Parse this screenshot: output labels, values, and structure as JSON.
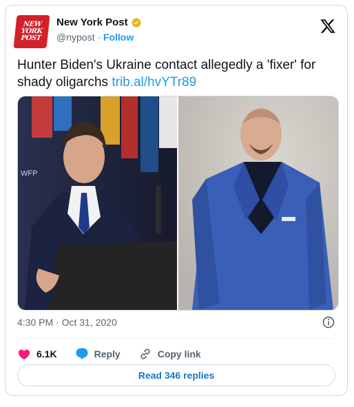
{
  "account": {
    "avatar_lines": [
      "NEW",
      "YORK",
      "POST"
    ],
    "name": "New York Post",
    "verified_icon": "verified-badge-icon",
    "handle": "@nypost",
    "separator": "·",
    "follow_label": "Follow"
  },
  "platform_icon": "x-logo-icon",
  "tweet": {
    "text": "Hunter Biden's Ukraine contact allegedly a 'fixer' for shady oligarchs",
    "link": "trib.al/hvYTr89",
    "timestamp": "4:30 PM · Oct 31, 2020"
  },
  "actions": {
    "likes_count": "6.1K",
    "reply_label": "Reply",
    "copy_link_label": "Copy link"
  },
  "read_replies_label": "Read 346 replies",
  "colors": {
    "accent": "#1d9bf0",
    "like": "#f91880",
    "avatar_bg": "#d3212a",
    "badge": "#e2b719"
  }
}
